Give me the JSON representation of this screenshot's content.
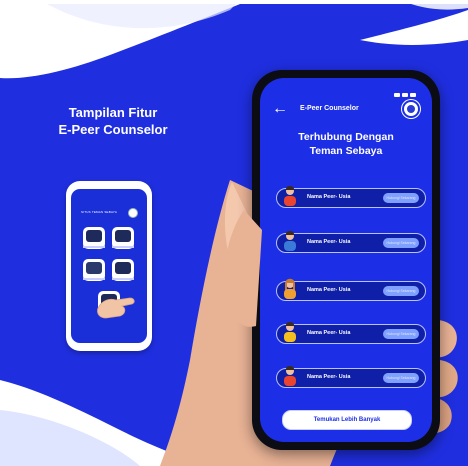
{
  "feature_title": {
    "line1": "Tampilan Fitur",
    "line2": "E-Peer Counselor"
  },
  "small_phone": {
    "header_text": "SITUS TEMAN SEBAYA",
    "tiles": [
      "tile-1",
      "tile-2",
      "tile-3",
      "tile-4",
      "tile-5"
    ]
  },
  "app": {
    "title": "E-Peer Counselor",
    "heading_line1": "Terhubung Dengan",
    "heading_line2": "Teman Sebaya",
    "peers": [
      {
        "name": "Nama Peer- Usia",
        "button": "Hubungi Sekarang"
      },
      {
        "name": "Nama Peer- Usia",
        "button": "Hubungi Sekarang"
      },
      {
        "name": "Nama Peer- Usia",
        "button": "Hubungi Sekarang"
      },
      {
        "name": "Nama Peer- Usia",
        "button": "Hubungi Sekarang"
      },
      {
        "name": "Nama Peer- Usia",
        "button": "Hubungi Sekarang"
      }
    ],
    "more_button": "Temukan Lebih Banyak"
  },
  "colors": {
    "background": "#1f2fe0",
    "accent": "#7fa0ff",
    "card": "#0f1fa8"
  },
  "icons": {
    "back": "arrow-left-icon",
    "logo": "app-logo-icon",
    "avatar": "person-avatar-icon"
  }
}
